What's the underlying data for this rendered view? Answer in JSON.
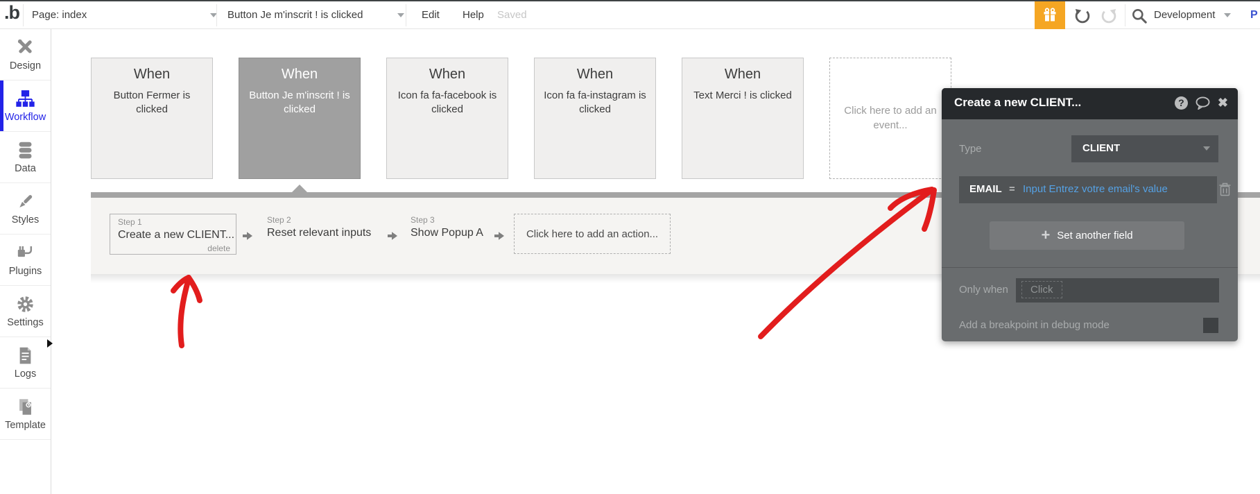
{
  "colors": {
    "accent_blue": "#2222e8",
    "selected_gray": "#a0a0a0",
    "gift_orange": "#f5a623",
    "annotation_red": "#e21d1d",
    "expression_blue": "#55a1e4",
    "popup_header": "#26292c",
    "popup_body": "#696c6e"
  },
  "topbar": {
    "logo": ".b",
    "page_selector": "Page: index",
    "event_selector": "Button Je m'inscrit ! is clicked",
    "edit": "Edit",
    "help": "Help",
    "saved": "Saved",
    "environment": "Development",
    "preview": "P"
  },
  "sidebar": {
    "items": [
      {
        "label": "Design"
      },
      {
        "label": "Workflow",
        "active": true
      },
      {
        "label": "Data"
      },
      {
        "label": "Styles"
      },
      {
        "label": "Plugins"
      },
      {
        "label": "Settings"
      },
      {
        "label": "Logs"
      },
      {
        "label": "Template"
      }
    ]
  },
  "events": [
    {
      "title": "When",
      "subtitle": "Button Fermer is clicked"
    },
    {
      "title": "When",
      "subtitle": "Button Je m'inscrit ! is clicked",
      "selected": true
    },
    {
      "title": "When",
      "subtitle": "Icon fa fa-facebook is clicked"
    },
    {
      "title": "When",
      "subtitle": "Icon fa fa-instagram is clicked"
    },
    {
      "title": "When",
      "subtitle": "Text Merci ! is clicked"
    },
    {
      "placeholder": "Click here to add an event..."
    }
  ],
  "steps": {
    "items": [
      {
        "label": "Step 1",
        "name": "Create a new CLIENT...",
        "delete_label": "delete"
      },
      {
        "label": "Step 2",
        "name": "Reset relevant inputs"
      },
      {
        "label": "Step 3",
        "name": "Show Popup A"
      }
    ],
    "add_placeholder": "Click here to add an action..."
  },
  "popup": {
    "title": "Create a new CLIENT...",
    "type_label": "Type",
    "type_value": "CLIENT",
    "field": {
      "name": "EMAIL",
      "operator": "=",
      "value": "Input Entrez votre email's value"
    },
    "set_another_field": "Set another field",
    "only_when_label": "Only when",
    "only_when_value": "Click",
    "breakpoint_label": "Add a breakpoint in debug mode"
  }
}
